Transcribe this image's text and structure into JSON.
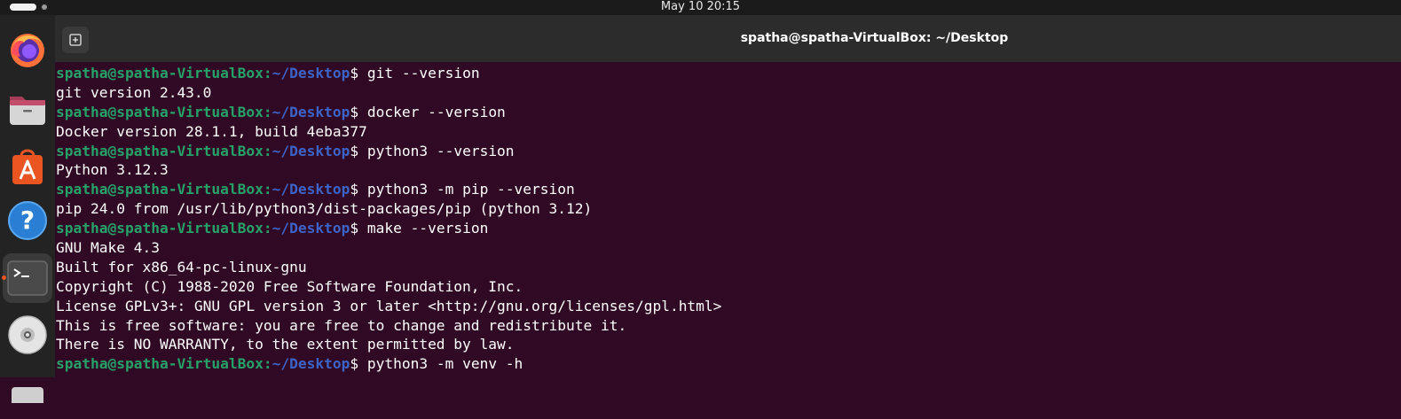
{
  "topbar": {
    "clock": "May 10  20:15"
  },
  "dock": {
    "items": [
      {
        "name": "firefox",
        "icon": "firefox-icon"
      },
      {
        "name": "files",
        "icon": "folder-icon"
      },
      {
        "name": "app-center",
        "icon": "store-icon"
      },
      {
        "name": "help",
        "icon": "help-icon"
      },
      {
        "name": "terminal",
        "icon": "terminal-icon",
        "active": true
      },
      {
        "name": "disc",
        "icon": "disc-icon"
      }
    ]
  },
  "window": {
    "title": "spatha@spatha-VirtualBox: ~/Desktop"
  },
  "terminal": {
    "prompt_user": "spatha@spatha-VirtualBox",
    "prompt_sep": ":",
    "prompt_path": "~/Desktop",
    "prompt_end": "$ ",
    "lines": [
      {
        "prompt": true,
        "text": "git --version"
      },
      {
        "prompt": false,
        "text": "git version 2.43.0"
      },
      {
        "prompt": true,
        "text": "docker --version"
      },
      {
        "prompt": false,
        "text": "Docker version 28.1.1, build 4eba377"
      },
      {
        "prompt": true,
        "text": "python3 --version"
      },
      {
        "prompt": false,
        "text": "Python 3.12.3"
      },
      {
        "prompt": true,
        "text": "python3 -m pip --version"
      },
      {
        "prompt": false,
        "text": "pip 24.0 from /usr/lib/python3/dist-packages/pip (python 3.12)"
      },
      {
        "prompt": true,
        "text": "make --version"
      },
      {
        "prompt": false,
        "text": "GNU Make 4.3"
      },
      {
        "prompt": false,
        "text": "Built for x86_64-pc-linux-gnu"
      },
      {
        "prompt": false,
        "text": "Copyright (C) 1988-2020 Free Software Foundation, Inc."
      },
      {
        "prompt": false,
        "text": "License GPLv3+: GNU GPL version 3 or later <http://gnu.org/licenses/gpl.html>"
      },
      {
        "prompt": false,
        "text": "This is free software: you are free to change and redistribute it."
      },
      {
        "prompt": false,
        "text": "There is NO WARRANTY, to the extent permitted by law."
      },
      {
        "prompt": true,
        "text": "python3 -m venv -h"
      }
    ]
  },
  "colors": {
    "terminal_bg": "#300a24",
    "prompt_user": "#26a269",
    "prompt_path": "#3c63c8",
    "accent": "#e95420"
  }
}
